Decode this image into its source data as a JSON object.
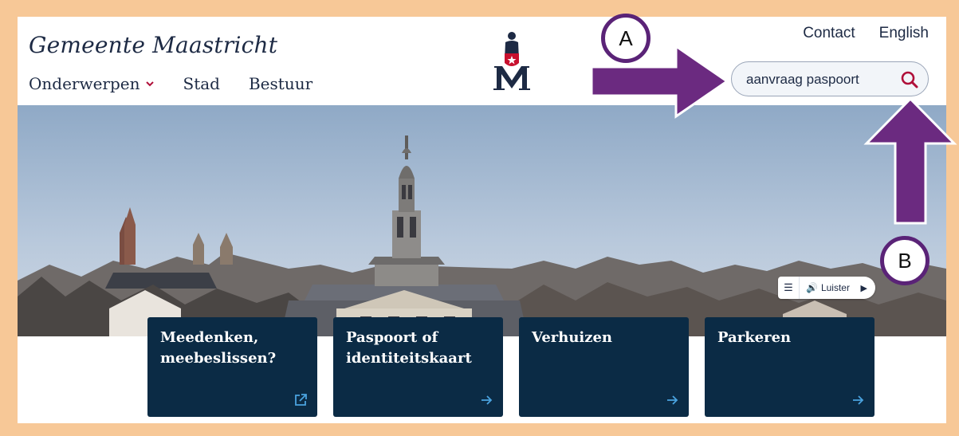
{
  "header": {
    "brand": "Gemeente Maastricht",
    "nav": [
      {
        "label": "Onderwerpen",
        "has_dropdown": true
      },
      {
        "label": "Stad"
      },
      {
        "label": "Bestuur"
      }
    ],
    "top_links": [
      "Contact",
      "English"
    ],
    "search": {
      "value": "aanvraag paspoort",
      "icon": "search-icon"
    },
    "logo": "maastricht-logo"
  },
  "listen": {
    "menu_icon": "menu-icon",
    "label": "Luister",
    "speaker_icon": "speaker-icon",
    "play_icon": "play-icon"
  },
  "tiles": [
    {
      "title": "Meedenken, meebeslissen?",
      "icon": "external-link-icon"
    },
    {
      "title": "Paspoort of identiteitskaart",
      "icon": "arrow-right-icon"
    },
    {
      "title": "Verhuizen",
      "icon": "arrow-right-icon"
    },
    {
      "title": "Parkeren",
      "icon": "arrow-right-icon"
    }
  ],
  "annotations": [
    {
      "label": "A"
    },
    {
      "label": "B"
    }
  ],
  "colors": {
    "frame": "#f7c897",
    "navy": "#0b2b45",
    "accent": "#b0103a",
    "annotation": "#6b2a80"
  }
}
